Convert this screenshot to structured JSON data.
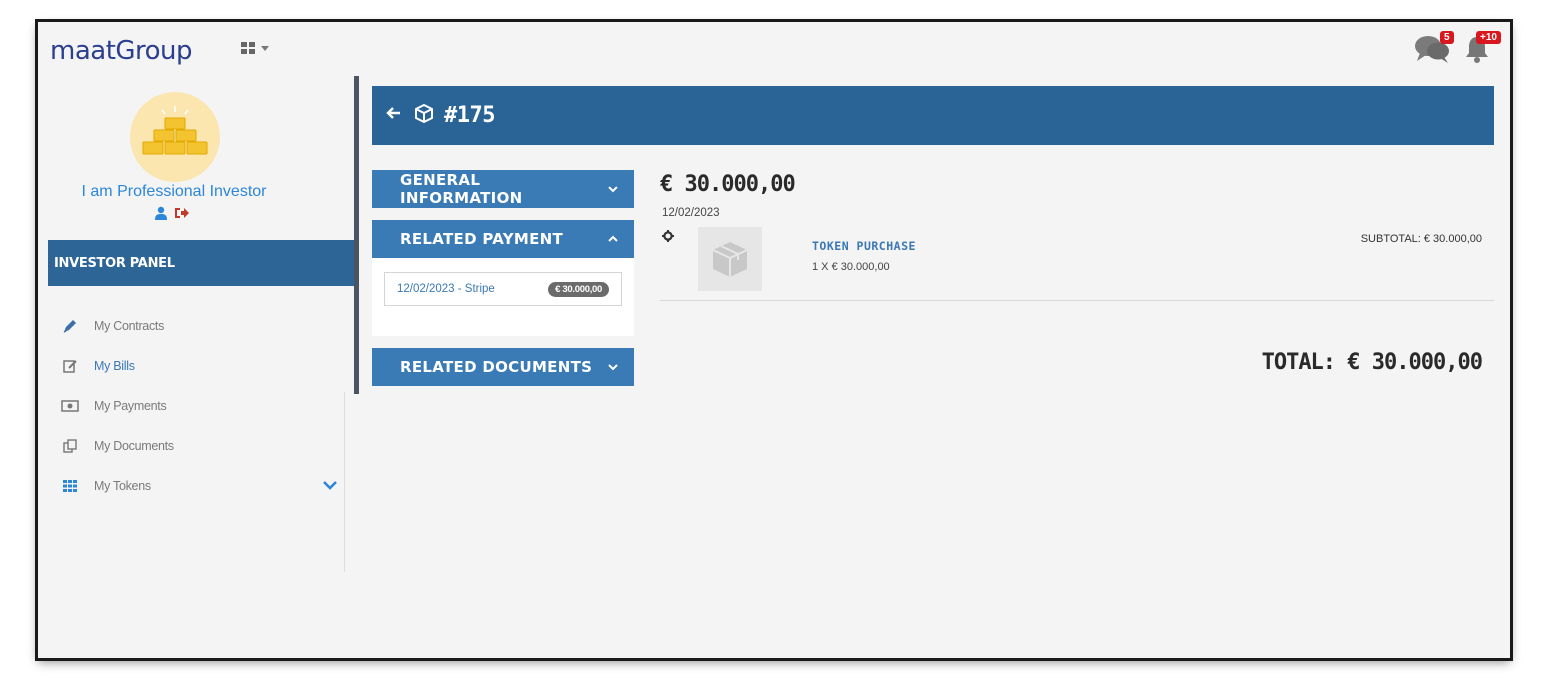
{
  "app": {
    "logo": "maatGroup"
  },
  "topbar": {
    "messages_badge": "5",
    "notifications_badge": "+10"
  },
  "sidebar": {
    "investor_name": "I am Professional Investor",
    "panel_title": "INVESTOR PANEL",
    "items": [
      {
        "label": "My Contracts",
        "icon": "pen-icon"
      },
      {
        "label": "My Bills",
        "icon": "edit-document-icon"
      },
      {
        "label": "My Payments",
        "icon": "money-bill-icon"
      },
      {
        "label": "My Documents",
        "icon": "documents-icon"
      },
      {
        "label": "My Tokens",
        "icon": "grid-icon"
      }
    ]
  },
  "header": {
    "order_number": "#175"
  },
  "accordion": {
    "general_information": "GENERAL INFORMATION",
    "related_payment": "RELATED PAYMENT",
    "related_documents": "RELATED DOCUMENTS",
    "payment": {
      "label": "12/02/2023 - Stripe",
      "amount": "€ 30.000,00"
    }
  },
  "detail": {
    "amount": "€ 30.000,00",
    "date": "12/02/2023",
    "item": {
      "name": "TOKEN PURCHASE",
      "quantity": "1 X € 30.000,00",
      "subtotal": "SUBTOTAL: € 30.000,00"
    },
    "total": "TOTAL: € 30.000,00"
  },
  "colors": {
    "primary": "#2a6496",
    "accordion": "#3a7bb5",
    "link": "#3b78b5",
    "badge": "#d9171e"
  }
}
